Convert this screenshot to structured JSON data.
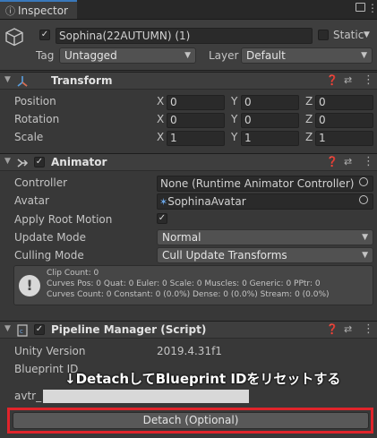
{
  "tab": {
    "title": "Inspector",
    "info_glyph": "ⓘ",
    "lock_glyph": "🔒",
    "menu_glyph": "⋮"
  },
  "gameobject": {
    "name": "Sophina(22AUTUMN) (1)",
    "static_label": "Static",
    "tag_label": "Tag",
    "tag_value": "Untagged",
    "layer_label": "Layer",
    "layer_value": "Default"
  },
  "transform": {
    "title": "Transform",
    "rows": [
      {
        "label": "Position",
        "x": "0",
        "y": "0",
        "z": "0"
      },
      {
        "label": "Rotation",
        "x": "0",
        "y": "0",
        "z": "0"
      },
      {
        "label": "Scale",
        "x": "1",
        "y": "1",
        "z": "1"
      }
    ],
    "axis_x": "X",
    "axis_y": "Y",
    "axis_z": "Z"
  },
  "animator": {
    "title": "Animator",
    "controller_label": "Controller",
    "controller_value": "None (Runtime Animator Controller)",
    "avatar_label": "Avatar",
    "avatar_value": "SophinaAvatar",
    "root_motion_label": "Apply Root Motion",
    "update_mode_label": "Update Mode",
    "update_mode_value": "Normal",
    "culling_mode_label": "Culling Mode",
    "culling_mode_value": "Cull Update Transforms",
    "info_lines": [
      "Clip Count: 0",
      "Curves Pos: 0 Quat: 0 Euler: 0 Scale: 0 Muscles: 0 Generic: 0 PPtr: 0",
      "Curves Count: 0 Constant: 0 (0.0%) Dense: 0 (0.0%) Stream: 0 (0.0%)"
    ]
  },
  "pipeline": {
    "title": "Pipeline Manager (Script)",
    "unity_version_label": "Unity Version",
    "unity_version_value": "2019.4.31f1",
    "blueprint_label": "Blueprint ID",
    "blueprint_prefix": "avtr_",
    "annotation": "↓DetachしてBlueprint IDをリセットする",
    "detach_button": "Detach (Optional)"
  },
  "colors": {
    "highlight_border": "#e0242b",
    "window_bg": "#383838"
  }
}
